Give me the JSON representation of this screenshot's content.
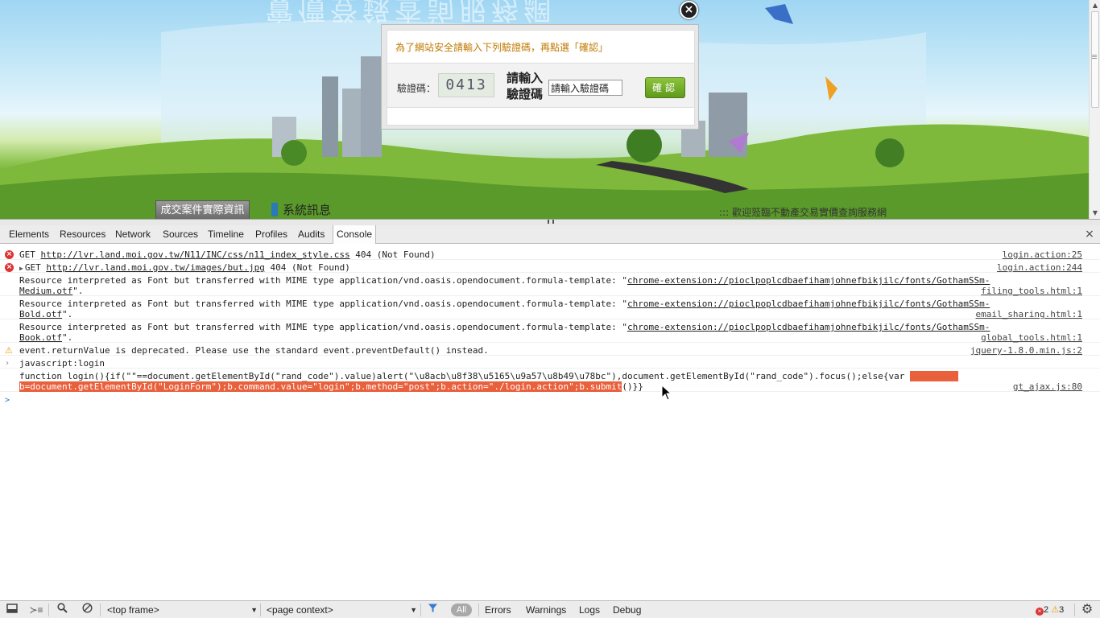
{
  "page": {
    "site_title": "實價登錄查詢服務網",
    "nav_button_label": "成交案件實際資訊",
    "system_news_label": "系統訊息",
    "welcome_text": "::: 歡迎蒞臨不動產交易實價查詢服務網"
  },
  "captcha_dialog": {
    "message": "為了網站安全請輸入下列驗證碼，再點選「確認」",
    "captcha_label": "驗證碼：",
    "captcha_image_text": "0413",
    "input_label": "請輸入驗證碼",
    "input_value": "請輸入驗證碼",
    "confirm_label": "確認",
    "close_icon": "close-icon"
  },
  "devtools": {
    "tabs": [
      "Elements",
      "Resources",
      "Network",
      "Sources",
      "Timeline",
      "Profiles",
      "Audits",
      "Console"
    ],
    "active_tab": "Console",
    "close_label": "×",
    "messages": [
      {
        "type": "error",
        "method": "GET",
        "url": "http://lvr.land.moi.gov.tw/N11/INC/css/n11_index_style.css",
        "status": "404 (Not Found)",
        "source": "login.action:25"
      },
      {
        "type": "error",
        "method": "GET",
        "url": "http://lvr.land.moi.gov.tw/images/but.jpg",
        "status": "404 (Not Found)",
        "source": "login.action:244"
      },
      {
        "type": "log",
        "prefix": "Resource interpreted as Font but transferred with MIME type application/vnd.oasis.opendocument.formula-template: \"",
        "url_a": "chrome-extension://pioclpoplcdbaefihamjohnefbikjilc/fonts/GothamSSm-",
        "url_b": "Medium.otf",
        "suffix": "\".",
        "source": "filing_tools.html:1"
      },
      {
        "type": "log",
        "prefix": "Resource interpreted as Font but transferred with MIME type application/vnd.oasis.opendocument.formula-template: \"",
        "url_a": "chrome-extension://pioclpoplcdbaefihamjohnefbikjilc/fonts/GothamSSm-",
        "url_b": "Bold.otf",
        "suffix": "\".",
        "source": "email_sharing.html:1"
      },
      {
        "type": "log",
        "prefix": "Resource interpreted as Font but transferred with MIME type application/vnd.oasis.opendocument.formula-template: \"",
        "url_a": "chrome-extension://pioclpoplcdbaefihamjohnefbikjilc/fonts/GothamSSm-",
        "url_b": "Book.otf",
        "suffix": "\".",
        "source": "global_tools.html:1"
      },
      {
        "type": "warning",
        "text": "event.returnValue is deprecated. Please use the standard event.preventDefault() instead.",
        "source": "jquery-1.8.0.min.js:2"
      },
      {
        "type": "input",
        "text": "javascript:login"
      },
      {
        "type": "result",
        "line1": "function login(){if(\"\"==document.getElementById(\"rand_code\").value)alert(\"\\u8acb\\u8f38\\u5165\\u9a57\\u8b49\\u78bc\"),document.getElementById(\"rand_code\").focus();else{var ",
        "line2_highlight": "b=document.getElementById(\"LoginForm\");b.command.value=\"login\";b.method=\"post\";b.action=\"./login.action\";b.submit",
        "line2_rest": "()}}",
        "source": "gt_ajax.js:80"
      }
    ],
    "prompt_symbol": ">"
  },
  "statusbar": {
    "frame_select": "<top frame>",
    "context_select": "<page context>",
    "filter_all": "All",
    "filters": [
      "Errors",
      "Warnings",
      "Logs",
      "Debug"
    ],
    "error_count": "2",
    "warning_count": "3",
    "icons": [
      "dock-icon",
      "drawer-icon",
      "search-icon",
      "clear-icon",
      "filter-icon",
      "gear-icon"
    ]
  },
  "colors": {
    "error": "#d32020",
    "warning": "#e5a000",
    "highlight": "#e8603c",
    "link_blue": "#2458c9",
    "confirm_green": "#6aa825"
  }
}
